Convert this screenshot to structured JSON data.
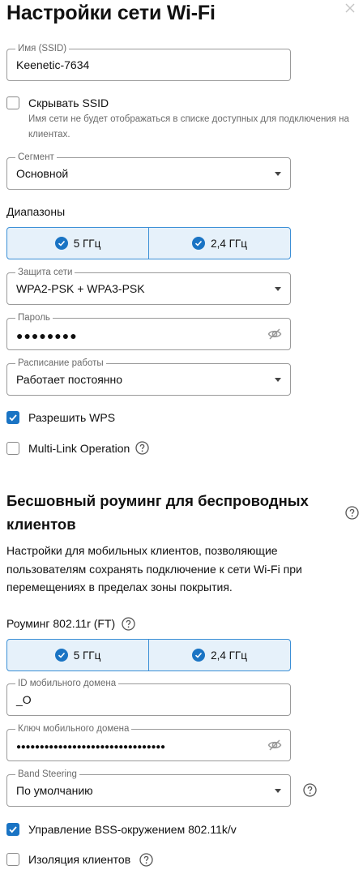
{
  "page": {
    "title": "Настройки сети Wi-Fi"
  },
  "ssid": {
    "legend": "Имя (SSID)",
    "value": "Keenetic-7634"
  },
  "hide_ssid": {
    "label": "Скрывать SSID",
    "checked": false,
    "hint": "Имя сети не будет отображаться в списке доступных для подключения на клиентах."
  },
  "segment": {
    "legend": "Сегмент",
    "value": "Основной"
  },
  "bands": {
    "label": "Диапазоны",
    "options": [
      {
        "label": "5 ГГц",
        "selected": true
      },
      {
        "label": "2,4 ГГц",
        "selected": true
      }
    ]
  },
  "security": {
    "legend": "Защита сети",
    "value": "WPA2-PSK + WPA3-PSK"
  },
  "password": {
    "legend": "Пароль",
    "value": "●●●●●●●●"
  },
  "schedule": {
    "legend": "Расписание работы",
    "value": "Работает постоянно"
  },
  "wps": {
    "label": "Разрешить WPS",
    "checked": true
  },
  "mlo": {
    "label": "Multi-Link Operation",
    "checked": false
  },
  "roaming": {
    "title": "Бесшовный роуминг для беспроводных клиентов",
    "description": "Настройки для мобильных клиентов, позволяющие пользователям сохранять подключение к сети Wi-Fi при перемещениях в пределах зоны покрытия.",
    "ft_label": "Роуминг 802.11r (FT)",
    "ft_bands": [
      {
        "label": "5 ГГц",
        "selected": true
      },
      {
        "label": "2,4 ГГц",
        "selected": true
      }
    ],
    "mobility_domain": {
      "legend": "ID мобильного домена",
      "value": "_O"
    },
    "mobility_key": {
      "legend": "Ключ мобильного домена",
      "value": "●●●●●●●●●●●●●●●●●●●●●●●●●●●●●●●●"
    },
    "band_steering": {
      "legend": "Band Steering",
      "value": "По умолчанию"
    },
    "bss_transition": {
      "label": "Управление BSS-окружением 802.11k/v",
      "checked": true
    },
    "client_isolation": {
      "label": "Изоляция клиентов",
      "checked": false
    }
  },
  "colors": {
    "accent": "#1a74c4",
    "selected_bg": "#e6f1fa",
    "border": "#9a9a9a"
  },
  "icons": [
    "close-icon",
    "eye-off-icon",
    "chevron-down-icon",
    "help-icon",
    "check-icon"
  ]
}
